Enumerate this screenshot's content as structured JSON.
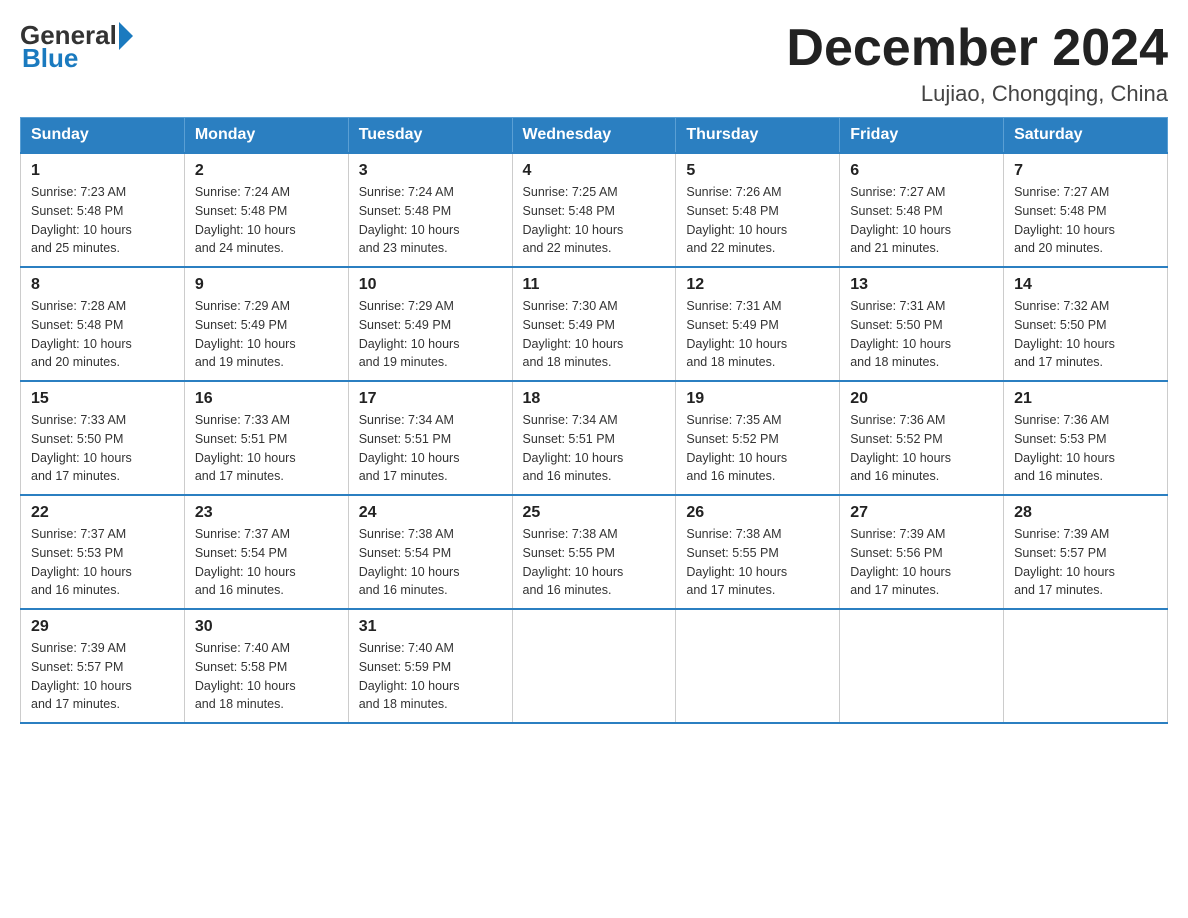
{
  "header": {
    "logo_general": "General",
    "logo_blue": "Blue",
    "month_title": "December 2024",
    "location": "Lujiao, Chongqing, China"
  },
  "weekdays": [
    "Sunday",
    "Monday",
    "Tuesday",
    "Wednesday",
    "Thursday",
    "Friday",
    "Saturday"
  ],
  "weeks": [
    [
      {
        "day": "1",
        "sunrise": "7:23 AM",
        "sunset": "5:48 PM",
        "daylight": "10 hours and 25 minutes."
      },
      {
        "day": "2",
        "sunrise": "7:24 AM",
        "sunset": "5:48 PM",
        "daylight": "10 hours and 24 minutes."
      },
      {
        "day": "3",
        "sunrise": "7:24 AM",
        "sunset": "5:48 PM",
        "daylight": "10 hours and 23 minutes."
      },
      {
        "day": "4",
        "sunrise": "7:25 AM",
        "sunset": "5:48 PM",
        "daylight": "10 hours and 22 minutes."
      },
      {
        "day": "5",
        "sunrise": "7:26 AM",
        "sunset": "5:48 PM",
        "daylight": "10 hours and 22 minutes."
      },
      {
        "day": "6",
        "sunrise": "7:27 AM",
        "sunset": "5:48 PM",
        "daylight": "10 hours and 21 minutes."
      },
      {
        "day": "7",
        "sunrise": "7:27 AM",
        "sunset": "5:48 PM",
        "daylight": "10 hours and 20 minutes."
      }
    ],
    [
      {
        "day": "8",
        "sunrise": "7:28 AM",
        "sunset": "5:48 PM",
        "daylight": "10 hours and 20 minutes."
      },
      {
        "day": "9",
        "sunrise": "7:29 AM",
        "sunset": "5:49 PM",
        "daylight": "10 hours and 19 minutes."
      },
      {
        "day": "10",
        "sunrise": "7:29 AM",
        "sunset": "5:49 PM",
        "daylight": "10 hours and 19 minutes."
      },
      {
        "day": "11",
        "sunrise": "7:30 AM",
        "sunset": "5:49 PM",
        "daylight": "10 hours and 18 minutes."
      },
      {
        "day": "12",
        "sunrise": "7:31 AM",
        "sunset": "5:49 PM",
        "daylight": "10 hours and 18 minutes."
      },
      {
        "day": "13",
        "sunrise": "7:31 AM",
        "sunset": "5:50 PM",
        "daylight": "10 hours and 18 minutes."
      },
      {
        "day": "14",
        "sunrise": "7:32 AM",
        "sunset": "5:50 PM",
        "daylight": "10 hours and 17 minutes."
      }
    ],
    [
      {
        "day": "15",
        "sunrise": "7:33 AM",
        "sunset": "5:50 PM",
        "daylight": "10 hours and 17 minutes."
      },
      {
        "day": "16",
        "sunrise": "7:33 AM",
        "sunset": "5:51 PM",
        "daylight": "10 hours and 17 minutes."
      },
      {
        "day": "17",
        "sunrise": "7:34 AM",
        "sunset": "5:51 PM",
        "daylight": "10 hours and 17 minutes."
      },
      {
        "day": "18",
        "sunrise": "7:34 AM",
        "sunset": "5:51 PM",
        "daylight": "10 hours and 16 minutes."
      },
      {
        "day": "19",
        "sunrise": "7:35 AM",
        "sunset": "5:52 PM",
        "daylight": "10 hours and 16 minutes."
      },
      {
        "day": "20",
        "sunrise": "7:36 AM",
        "sunset": "5:52 PM",
        "daylight": "10 hours and 16 minutes."
      },
      {
        "day": "21",
        "sunrise": "7:36 AM",
        "sunset": "5:53 PM",
        "daylight": "10 hours and 16 minutes."
      }
    ],
    [
      {
        "day": "22",
        "sunrise": "7:37 AM",
        "sunset": "5:53 PM",
        "daylight": "10 hours and 16 minutes."
      },
      {
        "day": "23",
        "sunrise": "7:37 AM",
        "sunset": "5:54 PM",
        "daylight": "10 hours and 16 minutes."
      },
      {
        "day": "24",
        "sunrise": "7:38 AM",
        "sunset": "5:54 PM",
        "daylight": "10 hours and 16 minutes."
      },
      {
        "day": "25",
        "sunrise": "7:38 AM",
        "sunset": "5:55 PM",
        "daylight": "10 hours and 16 minutes."
      },
      {
        "day": "26",
        "sunrise": "7:38 AM",
        "sunset": "5:55 PM",
        "daylight": "10 hours and 17 minutes."
      },
      {
        "day": "27",
        "sunrise": "7:39 AM",
        "sunset": "5:56 PM",
        "daylight": "10 hours and 17 minutes."
      },
      {
        "day": "28",
        "sunrise": "7:39 AM",
        "sunset": "5:57 PM",
        "daylight": "10 hours and 17 minutes."
      }
    ],
    [
      {
        "day": "29",
        "sunrise": "7:39 AM",
        "sunset": "5:57 PM",
        "daylight": "10 hours and 17 minutes."
      },
      {
        "day": "30",
        "sunrise": "7:40 AM",
        "sunset": "5:58 PM",
        "daylight": "10 hours and 18 minutes."
      },
      {
        "day": "31",
        "sunrise": "7:40 AM",
        "sunset": "5:59 PM",
        "daylight": "10 hours and 18 minutes."
      },
      null,
      null,
      null,
      null
    ]
  ],
  "labels": {
    "sunrise": "Sunrise:",
    "sunset": "Sunset:",
    "daylight": "Daylight:"
  }
}
